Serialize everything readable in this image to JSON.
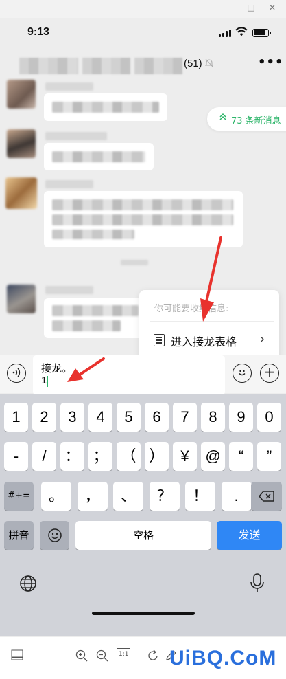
{
  "window_controls": {
    "minimize": "–",
    "maximize": "□",
    "close": "✕"
  },
  "status_bar": {
    "time": "9:13"
  },
  "chat_header": {
    "member_count": "(51)",
    "mute_icon": "bell-slash-icon",
    "more_label": "•••"
  },
  "new_messages_pill": {
    "arrow": "≈",
    "label": "73 条新消息"
  },
  "suggestion_popup": {
    "hint": "你可能要收集信息:",
    "action_label": "进入接龙表格",
    "action_icon": "list-icon",
    "chevron": "›"
  },
  "input": {
    "voice_icon": "voice-icon",
    "line1": "接龙。",
    "line2": "1",
    "emoji_icon": "emoji-icon",
    "plus_label": "+"
  },
  "keyboard": {
    "row1": [
      "1",
      "2",
      "3",
      "4",
      "5",
      "6",
      "7",
      "8",
      "9",
      "0"
    ],
    "row2": [
      "-",
      "/",
      "：",
      "；",
      "（",
      "）",
      "¥",
      "@",
      "“",
      "”"
    ],
    "row3_left": "#+=",
    "row3": [
      "。",
      "，",
      "、",
      "？",
      "！",
      "."
    ],
    "row3_right_icon": "backspace-icon",
    "row4": {
      "pinyin": "拼音",
      "emoji_icon": "emoji-icon",
      "space": "空格",
      "send": "发送"
    },
    "globe_icon": "globe-icon",
    "mic_icon": "microphone-icon"
  },
  "viewer_toolbar": {
    "icons": [
      "panel-icon",
      "zoom-in-icon",
      "zoom-out-icon",
      "actual-size-icon",
      "rotate-icon",
      "pen-icon"
    ],
    "actual_size_label": "1:1",
    "watermark": "UiBQ.CoM"
  },
  "colors": {
    "accent_green": "#2db56a",
    "send_blue": "#2f87f5",
    "annotation_red": "#e8322d"
  }
}
